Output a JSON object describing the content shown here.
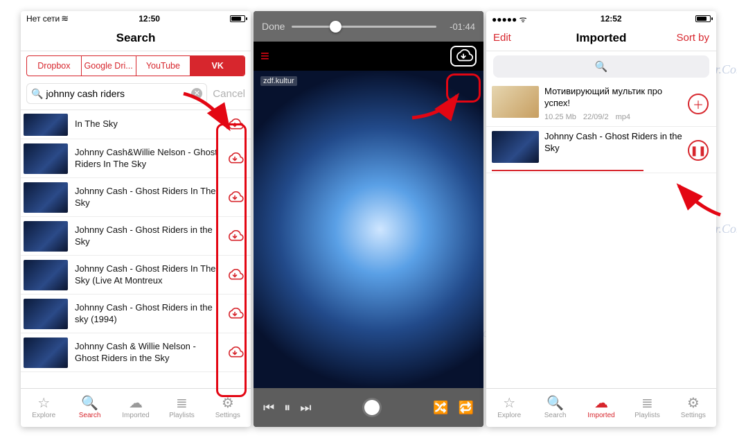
{
  "colors": {
    "accent": "#d7262d",
    "arrow": "#e30613"
  },
  "watermark": "Soringpcrepair.Com",
  "phone1": {
    "status": {
      "carrier": "Нет сети",
      "time": "12:50"
    },
    "header": {
      "title": "Search"
    },
    "source_tabs": [
      "Dropbox",
      "Google Dri...",
      "YouTube",
      "VK"
    ],
    "active_tab_index": 3,
    "search": {
      "value": "johnny cash riders",
      "cancel": "Cancel"
    },
    "results": [
      {
        "title": "In The Sky"
      },
      {
        "title": "Johnny Cash&Willie Nelson - Ghost Riders In The Sky"
      },
      {
        "title": "Johnny Cash - Ghost Riders In The Sky"
      },
      {
        "title": "Johnny Cash - Ghost Riders in the Sky"
      },
      {
        "title": "Johnny Cash - Ghost Riders In The Sky (Live At Montreux"
      },
      {
        "title": "Johnny Cash - Ghost Riders in the sky (1994)"
      },
      {
        "title": "Johnny Cash & Willie Nelson - Ghost Riders in the Sky"
      }
    ],
    "tabs": [
      "Explore",
      "Search",
      "Imported",
      "Playlists",
      "Settings"
    ],
    "active_bottom_tab": 1
  },
  "phone2": {
    "scrub": {
      "done": "Done",
      "remaining": "-01:44"
    },
    "cover_label": "zdf.kultur"
  },
  "phone3": {
    "status": {
      "carrier": "",
      "time": "12:52"
    },
    "header": {
      "left": "Edit",
      "title": "Imported",
      "right": "Sort by"
    },
    "items": [
      {
        "title": "Мотивирующий мультик про успех!",
        "size": "10.25 Mb",
        "date": "22/09/2",
        "fmt": "mp4",
        "action": "add"
      },
      {
        "title": "Johnny Cash - Ghost Riders in the Sky",
        "action": "pause"
      }
    ],
    "tabs": [
      "Explore",
      "Search",
      "Imported",
      "Playlists",
      "Settings"
    ],
    "active_bottom_tab": 2
  }
}
